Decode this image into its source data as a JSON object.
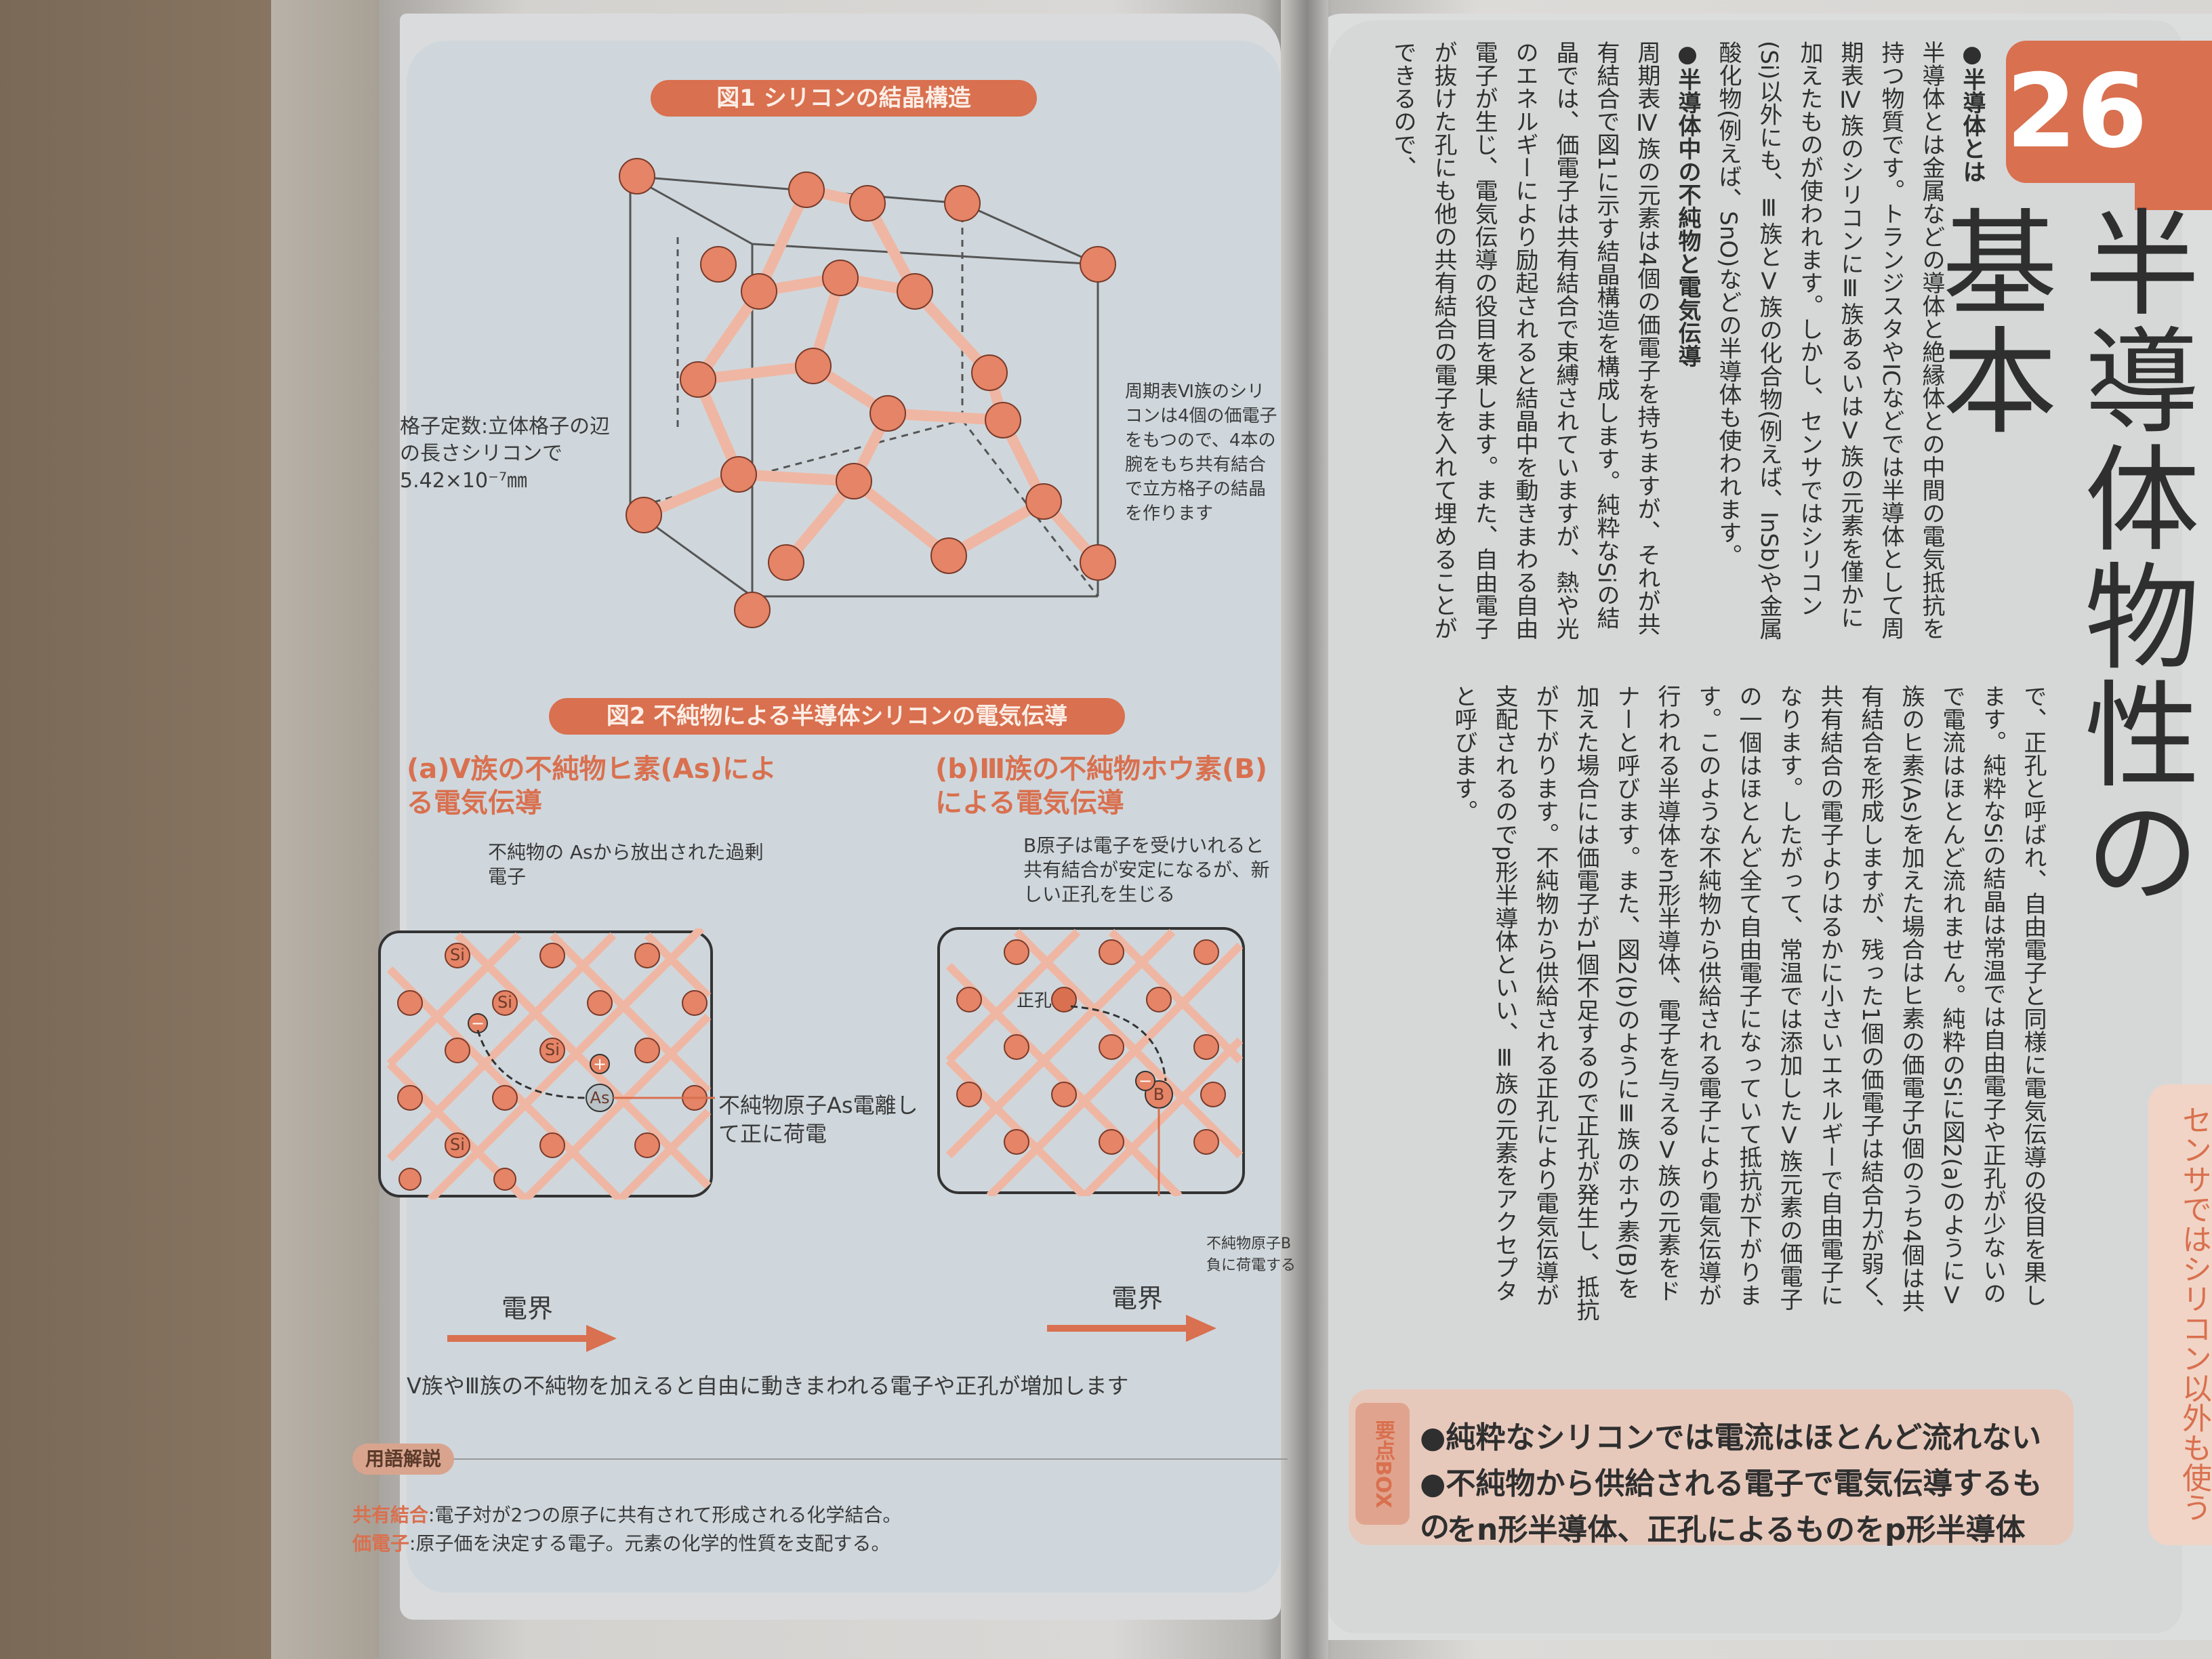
{
  "left_page": {
    "fig1_title": "図1 シリコンの結晶構造",
    "lattice_caption": "格子定数:立体格子の辺の長さシリコンで5.42×10⁻⁷㎜",
    "group6_caption": "周期表Ⅵ族のシリコンは4個の価電子をもつので、4本の腕をもち共有結合で立方格子の結晶を作ります",
    "fig2_title": "図2 不純物による半導体シリコンの電気伝導",
    "sub_a": "(a)Ⅴ族の不純物ヒ素(As)による電気伝導",
    "sub_b": "(b)Ⅲ族の不純物ホウ素(B)による電気伝導",
    "note_a": "不純物の Asから放出された過剰電子",
    "note_a2": "不純物原子As電離して正に荷電",
    "note_b": "B原子は電子を受けいれると共有結合が安定になるが、新しい正孔を生じる",
    "note_b2": "不純物原子B負に荷電する",
    "hole_label": "正孔",
    "si": "Si",
    "as": "As",
    "b": "B",
    "plus": "+",
    "minus": "−",
    "efield": "電界",
    "summary_line": "Ⅴ族やⅢ族の不純物を加えると自由に動きまわれる電子や正孔が増加します",
    "glossary_tag": "用語解説",
    "gloss1_term": "共有結合",
    "gloss1_text": ":電子対が2つの原子に共有されて形成される化学結合。",
    "gloss2_term": "価電子",
    "gloss2_text": ":原子価を決定する電子。元素の化学的性質を支配する。"
  },
  "right_page": {
    "chapter_number": "26",
    "chapter_title": "半導体物性の基本",
    "side_tab": "センサではシリコン以外も使う",
    "sec1_head": "●半導体とは",
    "sec1_body": "半導体とは金属などの導体と絶縁体との中間の電気抵抗を持つ物質です。トランジスタやICなどでは半導体として周期表Ⅳ族のシリコンにⅢ族あるいはⅤ族の元素を僅かに加えたものが使われます。しかし、センサではシリコン(Si)以外にも、Ⅲ族とⅤ族の化合物(例えば、InSb)や金属酸化物(例えば、SnO)などの半導体も使われます。",
    "sec2_head": "●半導体中の不純物と電気伝導",
    "sec2_body": "周期表Ⅳ族の元素は4個の価電子を持ちますが、それが共有結合で図1に示す結晶構造を構成します。純粋なSiの結晶では、価電子は共有結合で束縛されていますが、熱や光のエネルギーにより励起されると結晶中を動きまわる自由電子が生じ、電気伝導の役目を果します。また、自由電子が抜けた孔にも他の共有結合の電子を入れて埋めることができるので、",
    "col2_body": "で、正孔と呼ばれ、自由電子と同様に電気伝導の役目を果します。純粋なSiの結晶は常温では自由電子や正孔が少ないので電流はほとんど流れません。純粋のSiに図2(a)のようにⅤ族のヒ素(As)を加えた場合はヒ素の価電子5個のうち4個は共有結合を形成しますが、残った1個の価電子は結合力が弱く、共有結合の電子よりはるかに小さいエネルギーで自由電子になります。したがって、常温では添加したⅤ族元素の価電子の一個はほとんど全て自由電子になっていて抵抗が下がります。このような不純物から供給される電子により電気伝導が行われる半導体をn形半導体、電子を与えるⅤ族の元素をドナーと呼びます。また、図2(b)のようにⅢ族のホウ素(B)を加えた場合には価電子が1個不足するので正孔が発生し、抵抗が下がります。不純物から供給される正孔により電気伝導が支配されるのでp形半導体といい、Ⅲ族の元素をアクセプタと呼びます。",
    "summary_tag": "要点BOX",
    "summary1": "●純粋なシリコンでは電流はほとんど流れない",
    "summary2": "●不純物から供給される電子で電気伝導するもの",
    "summary3": "をn形半導体、正孔によるものをp形半導体"
  },
  "colors": {
    "accent": "#d9704f",
    "atom": "#e58466",
    "bond": "#efb7a3",
    "panel": "#cfd7dc"
  }
}
